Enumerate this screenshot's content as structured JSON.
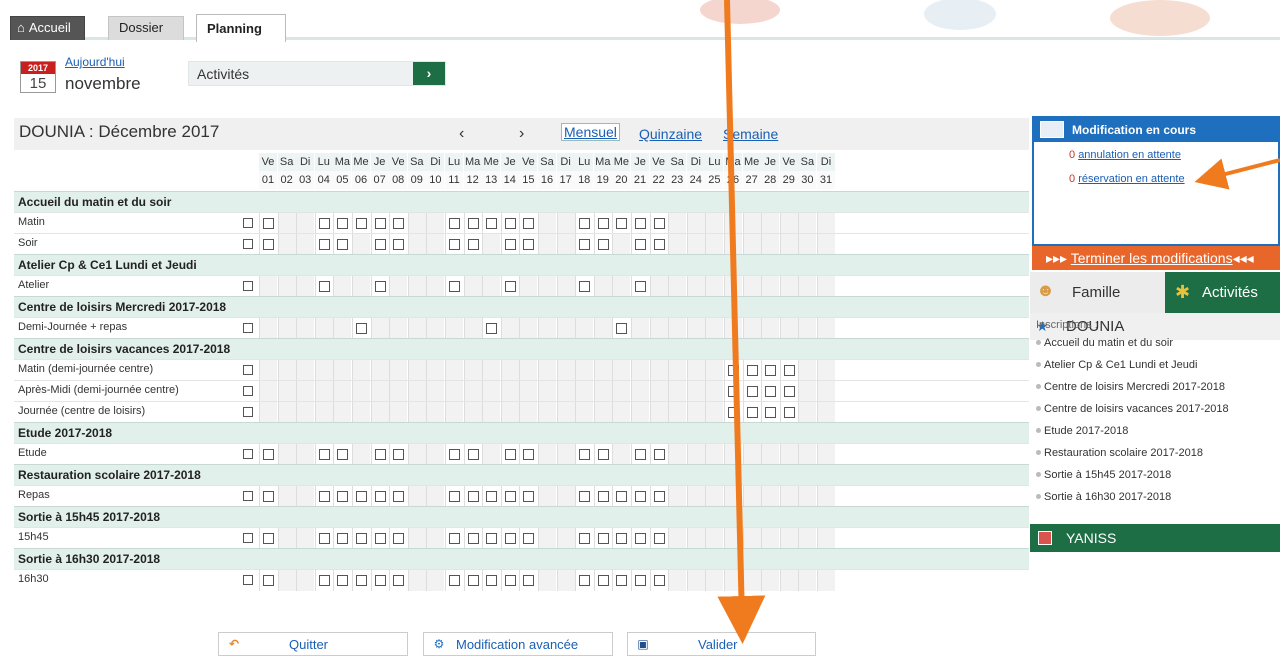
{
  "tabs": {
    "home": "Accueil",
    "dossier": "Dossier",
    "planning": "Planning"
  },
  "date": {
    "year": "2017",
    "day": "15",
    "month": "novembre",
    "today_link": "Aujourd'hui"
  },
  "activity_select": {
    "value": "Activités",
    "go": "›"
  },
  "grid": {
    "title": "DOUNIA : Décembre 2017",
    "prev": "‹",
    "next": "›",
    "views": {
      "monthly": "Mensuel",
      "fortnight": "Quinzaine",
      "week": "Semaine"
    },
    "weekdays": [
      "Ve",
      "Sa",
      "Di",
      "Lu",
      "Ma",
      "Me",
      "Je",
      "Ve",
      "Sa",
      "Di",
      "Lu",
      "Ma",
      "Me",
      "Je",
      "Ve",
      "Sa",
      "Di",
      "Lu",
      "Ma",
      "Me",
      "Je",
      "Ve",
      "Sa",
      "Di",
      "Lu",
      "Ma",
      "Me",
      "Je",
      "Ve",
      "Sa",
      "Di"
    ],
    "days": [
      "01",
      "02",
      "03",
      "04",
      "05",
      "06",
      "07",
      "08",
      "09",
      "10",
      "11",
      "12",
      "13",
      "14",
      "15",
      "16",
      "17",
      "18",
      "19",
      "20",
      "21",
      "22",
      "23",
      "24",
      "25",
      "26",
      "27",
      "28",
      "29",
      "30",
      "31"
    ],
    "sections": [
      {
        "title": "Accueil du matin et du soir",
        "rows": [
          {
            "label": "Matin",
            "days": [
              1,
              4,
              5,
              6,
              7,
              8,
              11,
              12,
              13,
              14,
              15,
              18,
              19,
              20,
              21,
              22
            ]
          },
          {
            "label": "Soir",
            "days": [
              1,
              4,
              5,
              7,
              8,
              11,
              12,
              14,
              15,
              18,
              19,
              21,
              22
            ]
          }
        ]
      },
      {
        "title": "Atelier Cp & Ce1 Lundi et Jeudi",
        "rows": [
          {
            "label": "Atelier",
            "days": [
              4,
              7,
              11,
              14,
              18,
              21
            ]
          }
        ]
      },
      {
        "title": "Centre de loisirs Mercredi 2017-2018",
        "rows": [
          {
            "label": "Demi-Journée + repas",
            "days": [
              6,
              13,
              20
            ]
          }
        ]
      },
      {
        "title": "Centre de loisirs vacances 2017-2018",
        "rows": [
          {
            "label": "Matin (demi-journée centre)",
            "days": [
              26,
              27,
              28,
              29
            ]
          },
          {
            "label": "Après-Midi (demi-journée centre)",
            "days": [
              26,
              27,
              28,
              29
            ]
          },
          {
            "label": "Journée (centre de loisirs)",
            "days": [
              26,
              27,
              28,
              29
            ]
          }
        ]
      },
      {
        "title": "Etude 2017-2018",
        "rows": [
          {
            "label": "Etude",
            "days": [
              1,
              4,
              5,
              7,
              8,
              11,
              12,
              14,
              15,
              18,
              19,
              21,
              22
            ]
          }
        ]
      },
      {
        "title": "Restauration scolaire 2017-2018",
        "rows": [
          {
            "label": "Repas",
            "days": [
              1,
              4,
              5,
              6,
              7,
              8,
              11,
              12,
              13,
              14,
              15,
              18,
              19,
              20,
              21,
              22
            ]
          }
        ]
      },
      {
        "title": "Sortie à 15h45 2017-2018",
        "rows": [
          {
            "label": "15h45",
            "days": [
              1,
              4,
              5,
              6,
              7,
              8,
              11,
              12,
              13,
              14,
              15,
              18,
              19,
              20,
              21,
              22
            ]
          }
        ]
      },
      {
        "title": "Sortie à 16h30 2017-2018",
        "rows": [
          {
            "label": "16h30",
            "days": [
              1,
              4,
              5,
              6,
              7,
              8,
              11,
              12,
              13,
              14,
              15,
              18,
              19,
              20,
              21,
              22
            ]
          }
        ]
      }
    ]
  },
  "buttons": {
    "quit": "Quitter",
    "advanced": "Modification avancée",
    "validate": "Valider"
  },
  "modification": {
    "title": "Modification en cours",
    "cancel_count": "0",
    "cancel_text": "annulation en attente",
    "reserve_count": "0",
    "reserve_text": "réservation en attente",
    "finish": "Terminer les modifications",
    "finish_prefix": "▸▸▸",
    "finish_suffix": "◂◂◂"
  },
  "side_tabs": {
    "family": "Famille",
    "activities": "Activités"
  },
  "child": {
    "name": "DOUNIA",
    "inscriptions_label": "Inscriptions :",
    "inscriptions": [
      "Accueil du matin et du soir",
      "Atelier Cp & Ce1 Lundi et Jeudi",
      "Centre de loisirs Mercredi 2017-2018",
      "Centre de loisirs vacances 2017-2018",
      "Etude 2017-2018",
      "Restauration scolaire 2017-2018",
      "Sortie à 15h45 2017-2018",
      "Sortie à 16h30 2017-2018"
    ]
  },
  "child2": {
    "name": "YANISS"
  },
  "colors": {
    "accent_blue": "#1f6fbf",
    "green": "#1e6e45",
    "orange": "#e8662a",
    "section_bg": "#e2f0ec"
  }
}
